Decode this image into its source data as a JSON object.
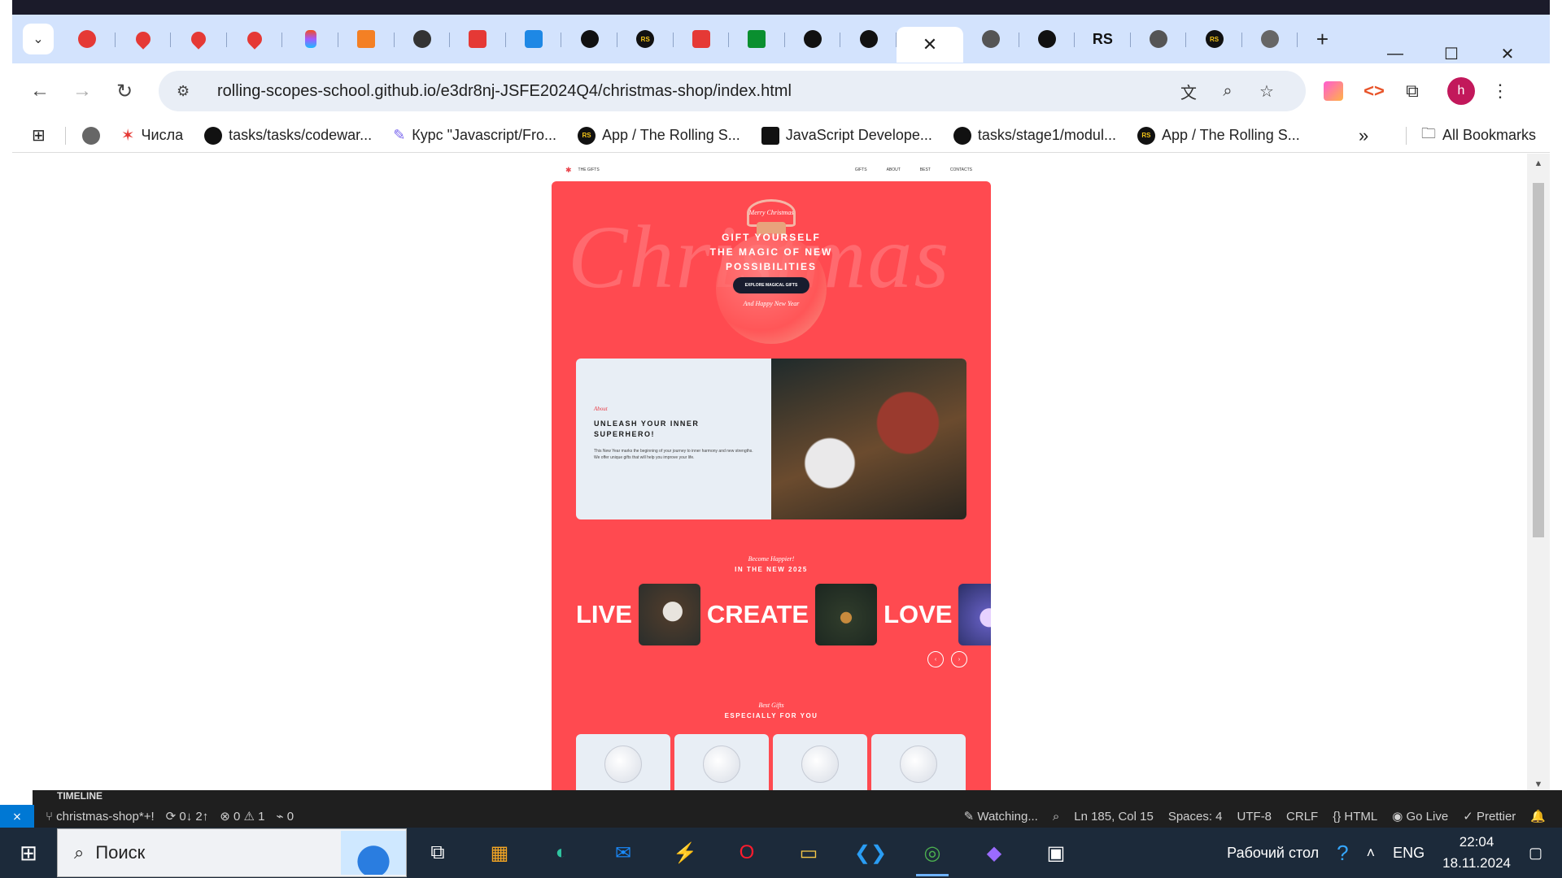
{
  "browser": {
    "active_tab_close": "✕",
    "new_tab": "+",
    "window_controls": {
      "minimize": "—",
      "maximize": "☐",
      "close": "✕"
    },
    "tabs_icons": [
      "santa-icon",
      "maps-icon",
      "maps-icon",
      "maps-icon",
      "figma-icon",
      "stackoverflow-icon",
      "sync-icon",
      "red-icon",
      "vscode-icon",
      "github-icon",
      "rs-icon",
      "css-icon",
      "w3-icon",
      "github-icon",
      "github-icon"
    ],
    "tabs_after": [
      "chrome-icon",
      "github-icon",
      "rs-text-icon",
      "chrome-icon",
      "rs-icon",
      "globe-icon"
    ],
    "rs_tab_text": "RS",
    "url": "rolling-scopes-school.github.io/e3dr8nj-JSFE2024Q4/christmas-shop/index.html",
    "profile_initial": "h"
  },
  "bookmarks": [
    {
      "icon": "globe-icon",
      "label": ""
    },
    {
      "icon": "chisla-icon",
      "label": "Числа"
    },
    {
      "icon": "github-icon",
      "label": "tasks/tasks/codewar..."
    },
    {
      "icon": "course-icon",
      "label": "Курс \"Javascript/Fro..."
    },
    {
      "icon": "rs-icon",
      "label": "App / The Rolling S..."
    },
    {
      "icon": "js-icon",
      "label": "JavaScript Develope..."
    },
    {
      "icon": "github-icon",
      "label": "tasks/stage1/modul..."
    },
    {
      "icon": "rs-icon",
      "label": "App / The Rolling S..."
    }
  ],
  "bookmarks_more": "»",
  "all_bookmarks": "All Bookmarks",
  "site": {
    "nav_logo": "THE GIFTS",
    "nav_links": [
      "GIFTS",
      "ABOUT",
      "BEST",
      "CONTACTS"
    ],
    "hero_bg_word": "Christmas",
    "hero_top": "Merry Christmas",
    "hero_title_lines": [
      "GIFT YOURSELF",
      "THE MAGIC OF NEW",
      "POSSIBILITIES"
    ],
    "hero_button": "EXPLORE MAGICAL GIFTS",
    "hero_bottom": "And Happy New Year",
    "about_caption": "About",
    "about_title": "UNLEASH YOUR INNER SUPERHERO!",
    "about_text": "This New Year marks the beginning of your journey to inner harmony and new strengths. We offer unique gifts that will help you improve your life.",
    "slider_caption": "Become Happier!",
    "slider_title": "IN THE NEW 2025",
    "slider_words": [
      "LIVE",
      "CREATE",
      "LOVE"
    ],
    "slider_prev": "‹",
    "slider_next": "›",
    "gifts_caption": "Best Gifts",
    "gifts_title": "ESPECIALLY FOR YOU"
  },
  "editor_status": {
    "timeline": "TIMELINE",
    "branch": "christmas-shop*+!",
    "sync": "0↓ 2↑",
    "errors": "0",
    "warnings": "1",
    "ports": "0",
    "watching": "Watching...",
    "position": "Ln 185, Col 15",
    "spaces": "Spaces: 4",
    "encoding": "UTF-8",
    "eol": "CRLF",
    "language": "HTML",
    "golive": "Go Live",
    "prettier": "Prettier"
  },
  "taskbar": {
    "search_placeholder": "Поиск",
    "apps": [
      "task-view-icon",
      "store-icon",
      "edge-icon",
      "outlook-icon",
      "cursor-icon",
      "opera-icon",
      "explorer-icon",
      "vscode-icon",
      "chrome-icon",
      "obsidian-icon",
      "terminal-icon"
    ],
    "desktop_label": "Рабочий стол",
    "lang": "ENG",
    "time": "22:04",
    "date": "18.11.2024"
  }
}
